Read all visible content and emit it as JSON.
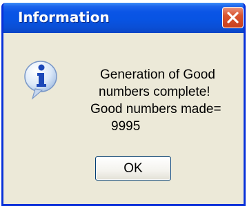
{
  "dialog": {
    "title": "Information",
    "icon": "information-icon",
    "message_lines": [
      "Generation of Good",
      "numbers complete!",
      "Good numbers made=",
      "9995"
    ],
    "ok_label": "OK"
  },
  "colors": {
    "titlebar": "#0a55e6",
    "window_body": "#ece9d8",
    "close_button": "#d9542f",
    "frame": "#0831d9"
  }
}
